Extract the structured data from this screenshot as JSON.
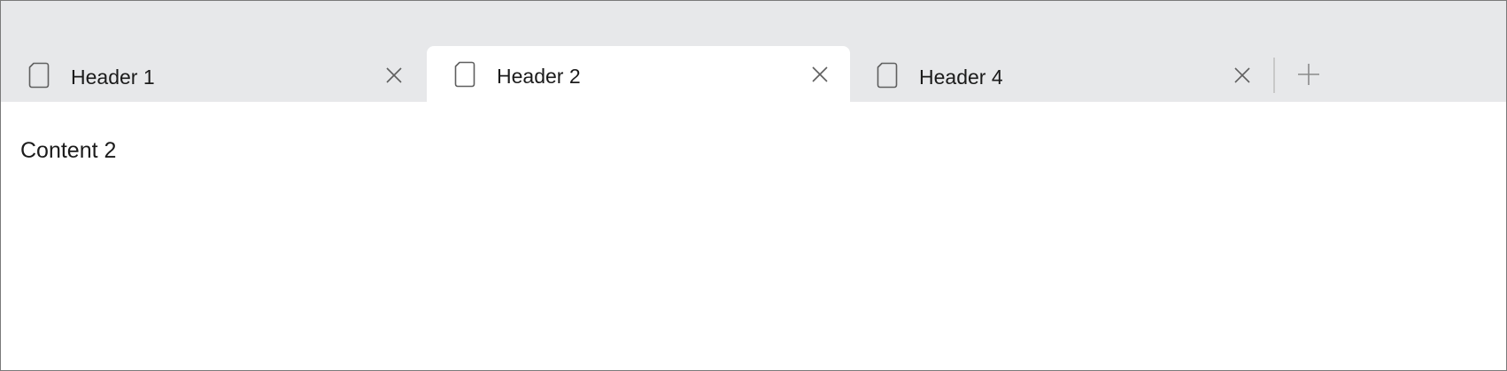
{
  "tabs": [
    {
      "label": "Header 1",
      "active": false,
      "icon": "document-icon",
      "close_icon": "close-icon"
    },
    {
      "label": "Header 2",
      "active": true,
      "icon": "document-icon",
      "close_icon": "close-icon"
    },
    {
      "label": "Header 4",
      "active": false,
      "icon": "document-icon",
      "close_icon": "close-icon"
    }
  ],
  "add_tab_icon": "plus-icon",
  "content": {
    "text": "Content 2"
  },
  "colors": {
    "tabstrip_background": "#e7e8ea",
    "active_tab_background": "#ffffff",
    "text": "#1b1b1b",
    "icon_stroke": "#5f5f5f",
    "window_border": "#7a7a7a"
  }
}
